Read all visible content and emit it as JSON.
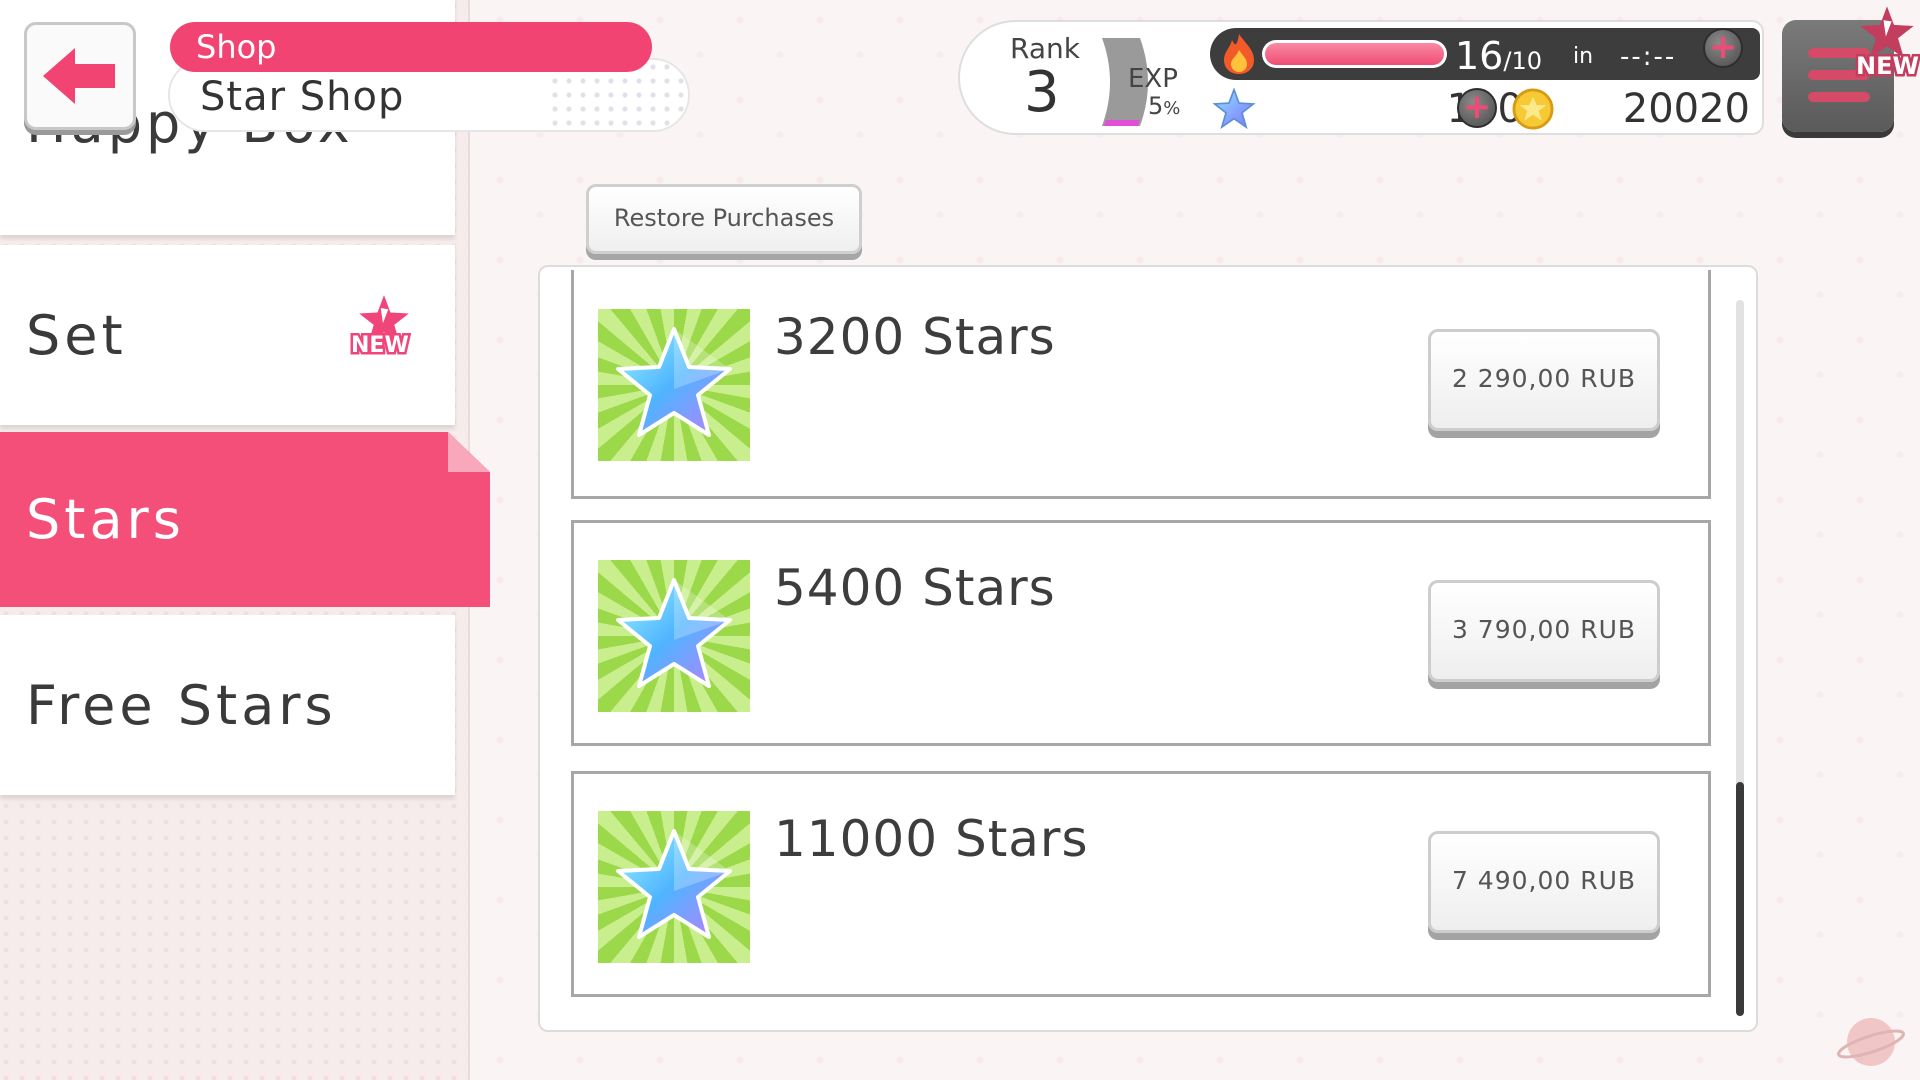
{
  "header": {
    "section_pill": "Shop",
    "title": "Star Shop"
  },
  "sidebar": {
    "items": [
      {
        "label": "Happy Box",
        "selected": false,
        "new_badge": false
      },
      {
        "label": "Set",
        "selected": false,
        "new_badge": true
      },
      {
        "label": "Stars",
        "selected": true,
        "new_badge": false
      },
      {
        "label": "Free Stars",
        "selected": false,
        "new_badge": false
      }
    ],
    "new_badge_label": "NEW"
  },
  "status": {
    "rank_label": "Rank",
    "rank_value": "3",
    "exp_label": "EXP",
    "exp_value": "5",
    "exp_unit": "%",
    "stamina_current": "16",
    "stamina_max": "/10",
    "stamina_in_label": "in",
    "stamina_timer": "--:--",
    "stamina_fill": 1.0,
    "stars_value": "100",
    "coins_value": "20020",
    "plus_symbol": "+"
  },
  "menu": {
    "new_badge_label": "NEW"
  },
  "main": {
    "restore_label": "Restore Purchases",
    "products": [
      {
        "name": "3200 Stars",
        "price": "2 290,00 RUB"
      },
      {
        "name": "5400 Stars",
        "price": "3 790,00 RUB"
      },
      {
        "name": "11000 Stars",
        "price": "7 490,00 RUB"
      }
    ]
  },
  "colors": {
    "accent_pink": "#f34f79",
    "icon_green": "#9bd94b",
    "dark_gray": "#3d3d3d"
  }
}
